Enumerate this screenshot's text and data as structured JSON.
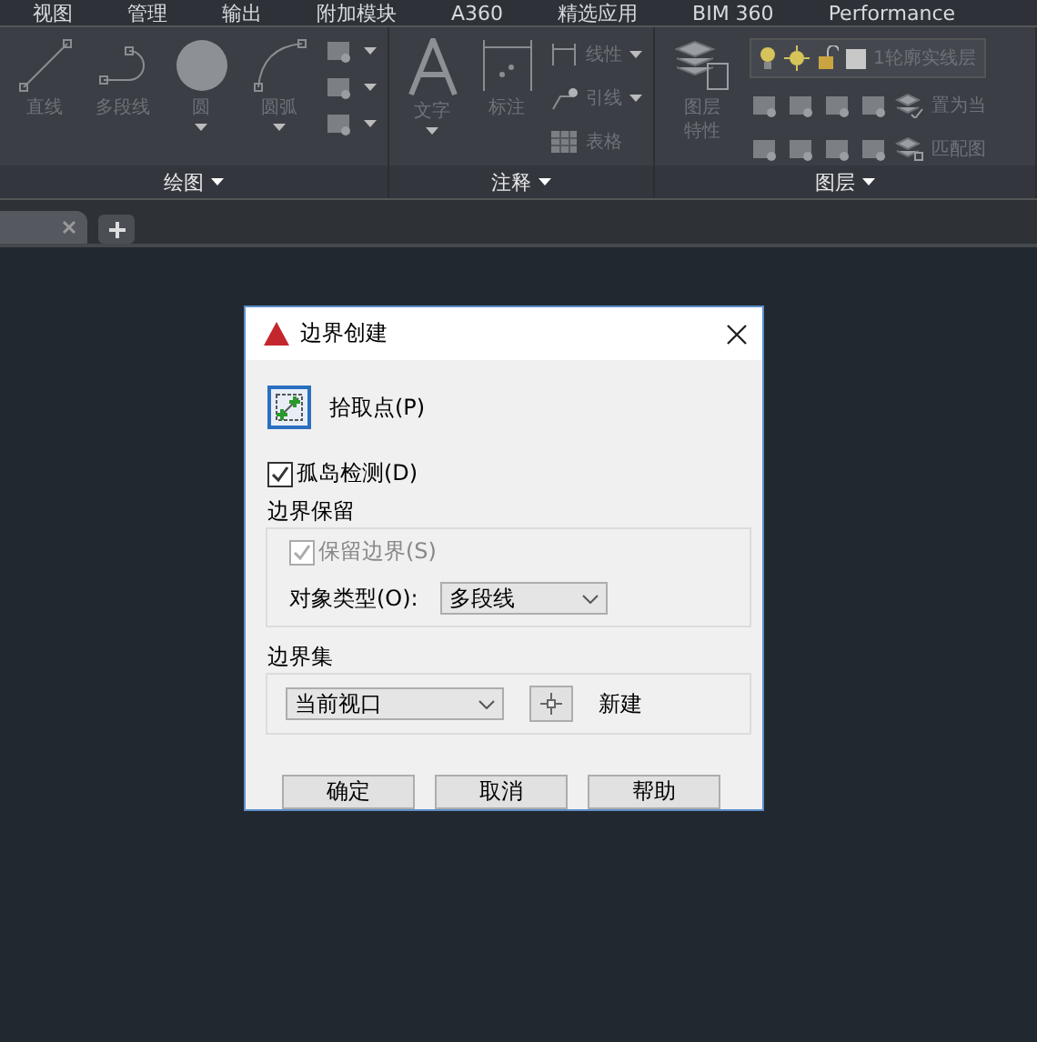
{
  "menu_bar": [
    "视图",
    "管理",
    "输出",
    "附加模块",
    "A360",
    "精选应用",
    "BIM 360",
    "Performance"
  ],
  "ribbon": {
    "disabled": true,
    "panels": [
      {
        "title": "绘图",
        "kind": "draw",
        "tools": [
          {
            "label": "直线",
            "kind": "line",
            "dropdown": false
          },
          {
            "label": "多段线",
            "kind": "polyline",
            "dropdown": false
          },
          {
            "label": "圆",
            "kind": "circle",
            "dropdown": true
          },
          {
            "label": "圆弧",
            "kind": "arc",
            "dropdown": true
          }
        ]
      },
      {
        "title": "注释",
        "kind": "annotate",
        "tools": [
          {
            "label": "文字",
            "kind": "text",
            "dropdown": true
          },
          {
            "label": "标注",
            "kind": "dimension",
            "dropdown": false
          }
        ],
        "small_tools": [
          {
            "label": "线性",
            "kind": "linear",
            "dropdown": true
          },
          {
            "label": "引线",
            "kind": "leader",
            "dropdown": true
          },
          {
            "label": "表格",
            "kind": "table",
            "dropdown": false
          }
        ]
      },
      {
        "title": "图层",
        "kind": "layers",
        "tools": [
          {
            "label": "图层特性",
            "kind": "layers",
            "dropdown": false
          }
        ],
        "layer": "1轮廓实线层",
        "small_tools": [
          {
            "label": "置为当",
            "kind": "current"
          },
          {
            "label": "匹配图",
            "kind": "match"
          }
        ]
      }
    ]
  },
  "dialog": {
    "title": "边界创建",
    "pick_points": "拾取点(P)",
    "island_detection": {
      "label": "孤岛检测(D)",
      "checked": true
    },
    "retain": {
      "title": "边界保留",
      "retain_boundaries": {
        "label": "保留边界(S)",
        "checked": true,
        "disabled": true
      },
      "object_type_label": "对象类型(O):",
      "object_type": "多段线"
    },
    "boundary_set": {
      "title": "边界集",
      "value": "当前视口",
      "new": "新建"
    },
    "buttons": [
      "确定",
      "取消",
      "帮助"
    ]
  }
}
